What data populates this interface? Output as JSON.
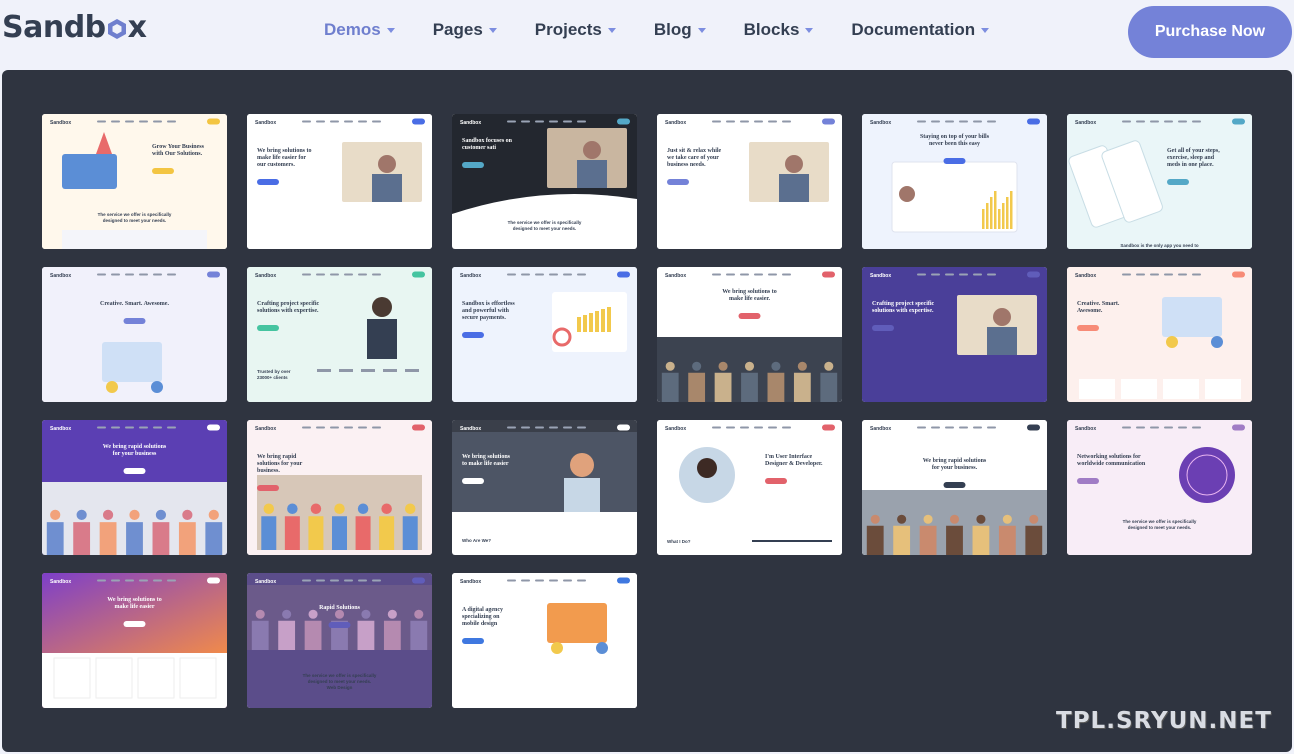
{
  "brand": {
    "name_part1": "Sandb",
    "name_part2": "x",
    "accent": "#6f7fce"
  },
  "nav": {
    "items": [
      {
        "label": "Demos",
        "active": true
      },
      {
        "label": "Pages",
        "active": false
      },
      {
        "label": "Projects",
        "active": false
      },
      {
        "label": "Blog",
        "active": false
      },
      {
        "label": "Blocks",
        "active": false
      },
      {
        "label": "Documentation",
        "active": false
      }
    ],
    "purchase_label": "Purchase Now"
  },
  "colors": {
    "primary": "#7482d8",
    "panel": "#2f3440",
    "text_dark": "#343f52"
  },
  "demos": [
    {
      "theme": "light-yellow",
      "headline": [
        "Grow Your Business",
        "with Our Solutions."
      ],
      "sub": [
        "The service we offer is specifically",
        "designed to meet your needs."
      ],
      "logo": "Sandbox",
      "accent": "#f3c542",
      "art": "rocket"
    },
    {
      "theme": "white-blue",
      "headline": [
        "We bring solutions to",
        "make life easier for",
        "our customers."
      ],
      "sub": [],
      "logo": "Sandbox",
      "accent": "#4a6de5",
      "art": "photo-office"
    },
    {
      "theme": "dark",
      "headline": [
        "Sandbox focuses on",
        "customer sati"
      ],
      "sub": [
        "The service we offer is specifically",
        "designed to meet your needs."
      ],
      "logo": "Sandbox",
      "accent": "#54a8c7",
      "art": "photo-hands"
    },
    {
      "theme": "white",
      "headline": [
        "Just sit & relax while",
        "we take care of your",
        "business needs."
      ],
      "sub": [],
      "logo": "Sandbox",
      "accent": "#7482d8",
      "art": "photo-team"
    },
    {
      "theme": "light-blue",
      "headline": [
        "Staying on top of your bills",
        "never been this easy"
      ],
      "sub": [],
      "logo": "Sandbox",
      "accent": "#4a6de5",
      "art": "dashboard"
    },
    {
      "theme": "light-teal",
      "headline": [
        "Get all of your steps,",
        "exercise, sleep and",
        "meds in one place."
      ],
      "sub": [
        "Sandbox is the only app you need to"
      ],
      "logo": "Sandbox",
      "accent": "#54a8c7",
      "art": "phones"
    },
    {
      "theme": "light-lilac",
      "headline": [
        "Creative. Smart. Awesome."
      ],
      "sub": [],
      "logo": "Sandbox",
      "accent": "#7482d8",
      "art": "illustration-board"
    },
    {
      "theme": "light-mint",
      "headline": [
        "Crafting project specific",
        "solutions with expertise."
      ],
      "sub": [
        "Trusted by over",
        "23000+ clients"
      ],
      "logo": "Sandbox",
      "accent": "#45c4a0",
      "art": "woman"
    },
    {
      "theme": "light-blue",
      "headline": [
        "Sandbox is effortless",
        "and powerful with",
        "secure payments."
      ],
      "sub": [],
      "logo": "Sandbox",
      "accent": "#4a6de5",
      "art": "charts"
    },
    {
      "theme": "white",
      "headline": [
        "We bring solutions to",
        "make life easier."
      ],
      "sub": [],
      "logo": "Sandbox",
      "accent": "#e2626b",
      "art": "photo-meeting"
    },
    {
      "theme": "purple",
      "headline": [
        "Crafting project specific",
        "solutions with expertise."
      ],
      "sub": [],
      "logo": "Sandbox",
      "accent": "#605dba",
      "art": "photo-man"
    },
    {
      "theme": "light-pink",
      "headline": [
        "Creative. Smart.",
        "Awesome."
      ],
      "sub": [],
      "logo": "Sandbox",
      "accent": "#f78b77",
      "art": "illustration-people"
    },
    {
      "theme": "purple-gradient",
      "headline": [
        "We bring rapid solutions",
        "for your business"
      ],
      "sub": [],
      "logo": "Sandbox",
      "accent": "#fff",
      "art": "photo-group"
    },
    {
      "theme": "light-pink2",
      "headline": [
        "We bring rapid",
        "solutions for your",
        "business."
      ],
      "sub": [],
      "logo": "Sandbox",
      "accent": "#e2626b",
      "art": "photo-workers"
    },
    {
      "theme": "dark-photo",
      "headline": [
        "We bring solutions",
        "to make life easier"
      ],
      "sub": [
        "Who Are We?"
      ],
      "logo": "Sandbox",
      "accent": "#fff",
      "art": "photo-boy"
    },
    {
      "theme": "white",
      "headline": [
        "I'm User Interface",
        "Designer & Developer."
      ],
      "sub": [
        "What I Do?"
      ],
      "logo": "Sandbox",
      "accent": "#e2626b",
      "art": "circle-photo"
    },
    {
      "theme": "white",
      "headline": [
        "We bring rapid solutions",
        "for your business."
      ],
      "sub": [],
      "logo": "Sandbox",
      "accent": "#343f52",
      "art": "photo-crowd"
    },
    {
      "theme": "light-pink3",
      "headline": [
        "Networking solutions for",
        "worldwide communication"
      ],
      "sub": [
        "The service we offer is specifically",
        "designed to meet your needs."
      ],
      "logo": "Sandbox",
      "accent": "#a07cc5",
      "art": "globe"
    },
    {
      "theme": "gradient",
      "headline": [
        "We bring solutions to",
        "make life easier"
      ],
      "sub": [],
      "logo": "Sandbox",
      "accent": "#fff",
      "art": "gradient-cards"
    },
    {
      "theme": "purple-photo",
      "headline": [
        "Rapid Solutions"
      ],
      "sub": [
        "The service we offer is specifically",
        "designed to meet your needs.",
        "Web Design"
      ],
      "logo": "Sandbox",
      "accent": "#605dba",
      "art": "photo-desk"
    },
    {
      "theme": "white",
      "headline": [
        "A digital agency",
        "specializing on",
        "mobile design"
      ],
      "sub": [],
      "logo": "Sandbox",
      "accent": "#3f78e0",
      "art": "illustration-mobile"
    }
  ],
  "watermark": "TPL.SRYUN.NET"
}
